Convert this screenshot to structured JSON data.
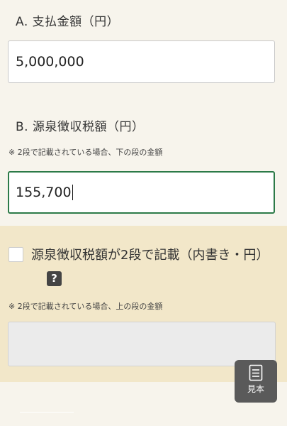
{
  "field_a": {
    "label": "A. 支払金額（円）",
    "value": "5,000,000"
  },
  "field_b": {
    "label": "B. 源泉徴収税額（円）",
    "note": "※ 2段で記載されている場合、下の段の金額",
    "value": "155,700"
  },
  "section_c": {
    "checkbox_checked": false,
    "checkbox_label": "源泉徴収税額が2段で記載（内書き・円）",
    "help_icon_glyph": "?",
    "note": "※ 2段で記載されている場合、上の段の金額",
    "value": ""
  },
  "sample_button": {
    "label": "見本",
    "icon": "document-icon"
  },
  "colors": {
    "page_background": "#f7f4ec",
    "section_background": "#f2e7c9",
    "focus_border": "#2c7a48",
    "button_background": "#5a5a5a"
  }
}
